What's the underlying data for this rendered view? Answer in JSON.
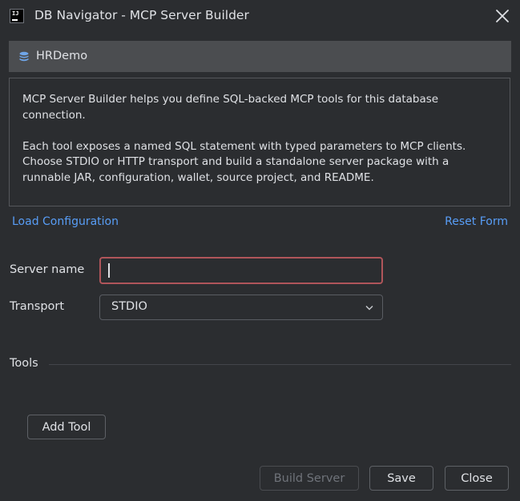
{
  "window": {
    "app_icon_text": "IJ",
    "title": "DB Navigator - MCP Server Builder"
  },
  "connection": {
    "name": "HRDemo"
  },
  "description": {
    "paragraph1": "MCP Server Builder helps you define SQL-backed MCP tools for this database\nconnection.",
    "paragraph2": "Each tool exposes a named SQL statement with typed parameters to MCP clients.\nChoose STDIO or HTTP transport and build a standalone server package with a\nrunnable JAR, configuration, wallet, source project, and README."
  },
  "links": {
    "load": "Load Configuration",
    "reset": "Reset Form"
  },
  "form": {
    "server_name_label": "Server name",
    "server_name_value": "",
    "transport_label": "Transport",
    "transport_value": "STDIO"
  },
  "tools": {
    "section_label": "Tools",
    "add_label": "Add Tool"
  },
  "footer": {
    "build_label": "Build Server",
    "save_label": "Save",
    "close_label": "Close"
  },
  "colors": {
    "link": "#589df6",
    "error_border": "#b0555a",
    "background": "#2b2d30"
  }
}
